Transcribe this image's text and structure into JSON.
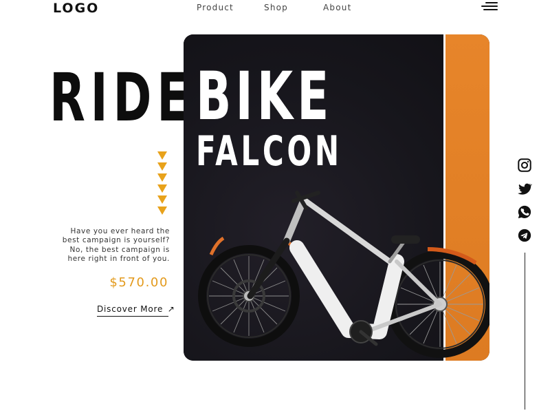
{
  "header": {
    "logo": "LOGO",
    "nav": [
      "Product",
      "Shop",
      "About"
    ],
    "menu_icon": "hamburger-menu-icon"
  },
  "hero": {
    "headline_left": "RIDE",
    "headline_right": "BIKE",
    "subheadline": "FALCON",
    "description": "Have you ever heard the best campaign is yourself? No, the best campaign is here right in front of you.",
    "price": "$570.00",
    "cta": "Discover More",
    "cta_icon": "arrow-up-right-icon",
    "accent_color": "#e39a1c",
    "panel_color": "#17161c",
    "stripe_color": "#e3822a"
  },
  "social": {
    "icons": [
      "instagram-icon",
      "twitter-icon",
      "whatsapp-icon",
      "telegram-icon"
    ]
  }
}
